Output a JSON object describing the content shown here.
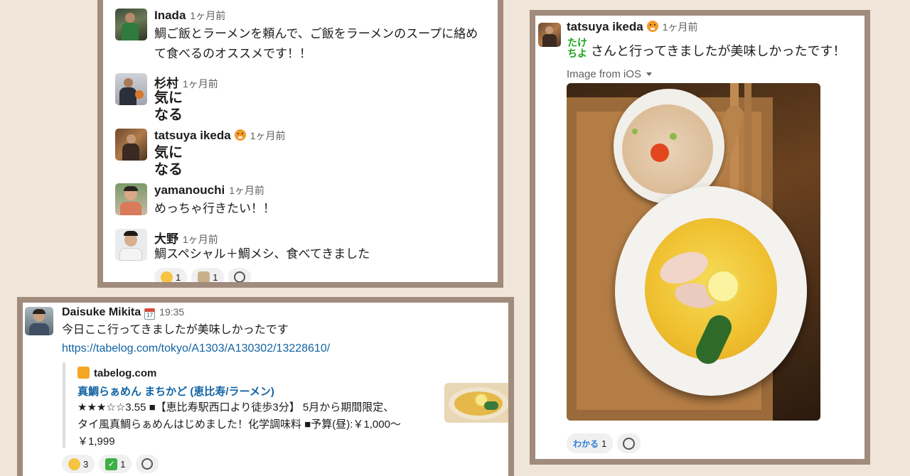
{
  "panel_a": {
    "messages": [
      {
        "name": "Inada",
        "time": "1ヶ月前",
        "text_line1": "鯛ご飯とラーメンを頼んで、ご飯をラーメンのスープに絡め",
        "text_line2": "て食べるのオススメです！！"
      },
      {
        "name": "杉村",
        "time": "1ヶ月前",
        "big_line1": "気に",
        "big_line2": "なる"
      },
      {
        "name": "tatsuya ikeda",
        "time": "1ヶ月前",
        "status_icon": "tiger-emoji",
        "big_line1": "気に",
        "big_line2": "なる"
      },
      {
        "name": "yamanouchi",
        "time": "1ヶ月前",
        "text_line1": "めっちゃ行きたい！！"
      },
      {
        "name": "大野",
        "time": "1ヶ月前",
        "text_line1": "鯛スペシャル＋鯛メシ、食べてきました"
      }
    ],
    "reactions": [
      {
        "icon": "pleading-face-emoji",
        "count": "1"
      },
      {
        "icon": "ramen-cat-emoji",
        "count": "1"
      }
    ]
  },
  "panel_b": {
    "name": "Daisuke Mikita",
    "status_icon": "calendar-emoji",
    "calendar_day": "17",
    "time": "19:35",
    "text": "今日ここ行ってきましたが美味しかったです",
    "url": "https://tabelog.com/tokyo/A1303/A130302/13228610/",
    "unfurl": {
      "site": "tabelog.com",
      "title": "真鯛らぁめん まちかど (恵比寿/ラーメン)",
      "desc_line1": "★★★☆☆3.55 ■【恵比寿駅西口より徒歩3分】 5月から期間限定、",
      "desc_line2": "タイ風真鯛らぁめんはじめました！化学調味料 ■予算(昼):￥1,000〜",
      "desc_line3": "￥1,999"
    },
    "reactions": [
      {
        "icon": "yum-face-emoji",
        "count": "3"
      },
      {
        "icon": "check-mark-emoji",
        "count": "1"
      }
    ]
  },
  "panel_c": {
    "name": "tatsuya ikeda",
    "status_icon": "tiger-emoji",
    "time": "1ヶ月前",
    "stamp_top": "たけ",
    "stamp_bottom": "ちよ",
    "text": "さんと行ってきましたが美味しかったです！",
    "image_caption": "Image from iOS",
    "reactions": [
      {
        "icon": "wakaru-stamp",
        "label": "わかる",
        "count": "1"
      }
    ]
  },
  "colors": {
    "frame": "#a08b7d",
    "background": "#efe6d9",
    "link": "#1264a3",
    "stamp_green": "#1aa31a"
  }
}
